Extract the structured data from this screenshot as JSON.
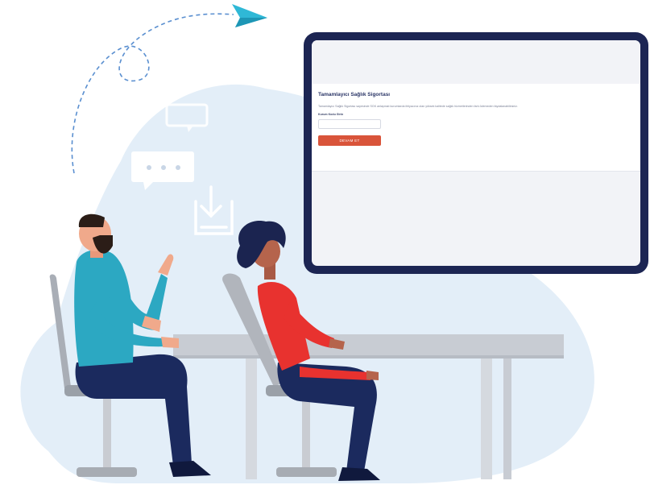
{
  "form": {
    "title": "Tamamlayıcı Sağlık Sigortası",
    "description": "Tamamlayıcı Sağlık Sigortası sayesinde SGK anlaşmalı kurumlarda ihtiyacınız olan yüksek kalitede sağlık hizmetlerinden fark ödemeden faydalanabilirsiniz.",
    "field_label": "Kurum Kodu Girin",
    "field_value": "",
    "field_placeholder": "",
    "submit_label": "DEVAM ET"
  },
  "colors": {
    "monitor_frame": "#1c2553",
    "accent_button": "#d9543a",
    "blob_background": "#e3eef8",
    "man_shirt": "#2ca8c2",
    "woman_shirt": "#e8322f",
    "pants": "#1b2a5e"
  },
  "icons": [
    "paper-plane-icon",
    "chat-bubble-icon",
    "typing-bubble-icon",
    "download-icon"
  ]
}
